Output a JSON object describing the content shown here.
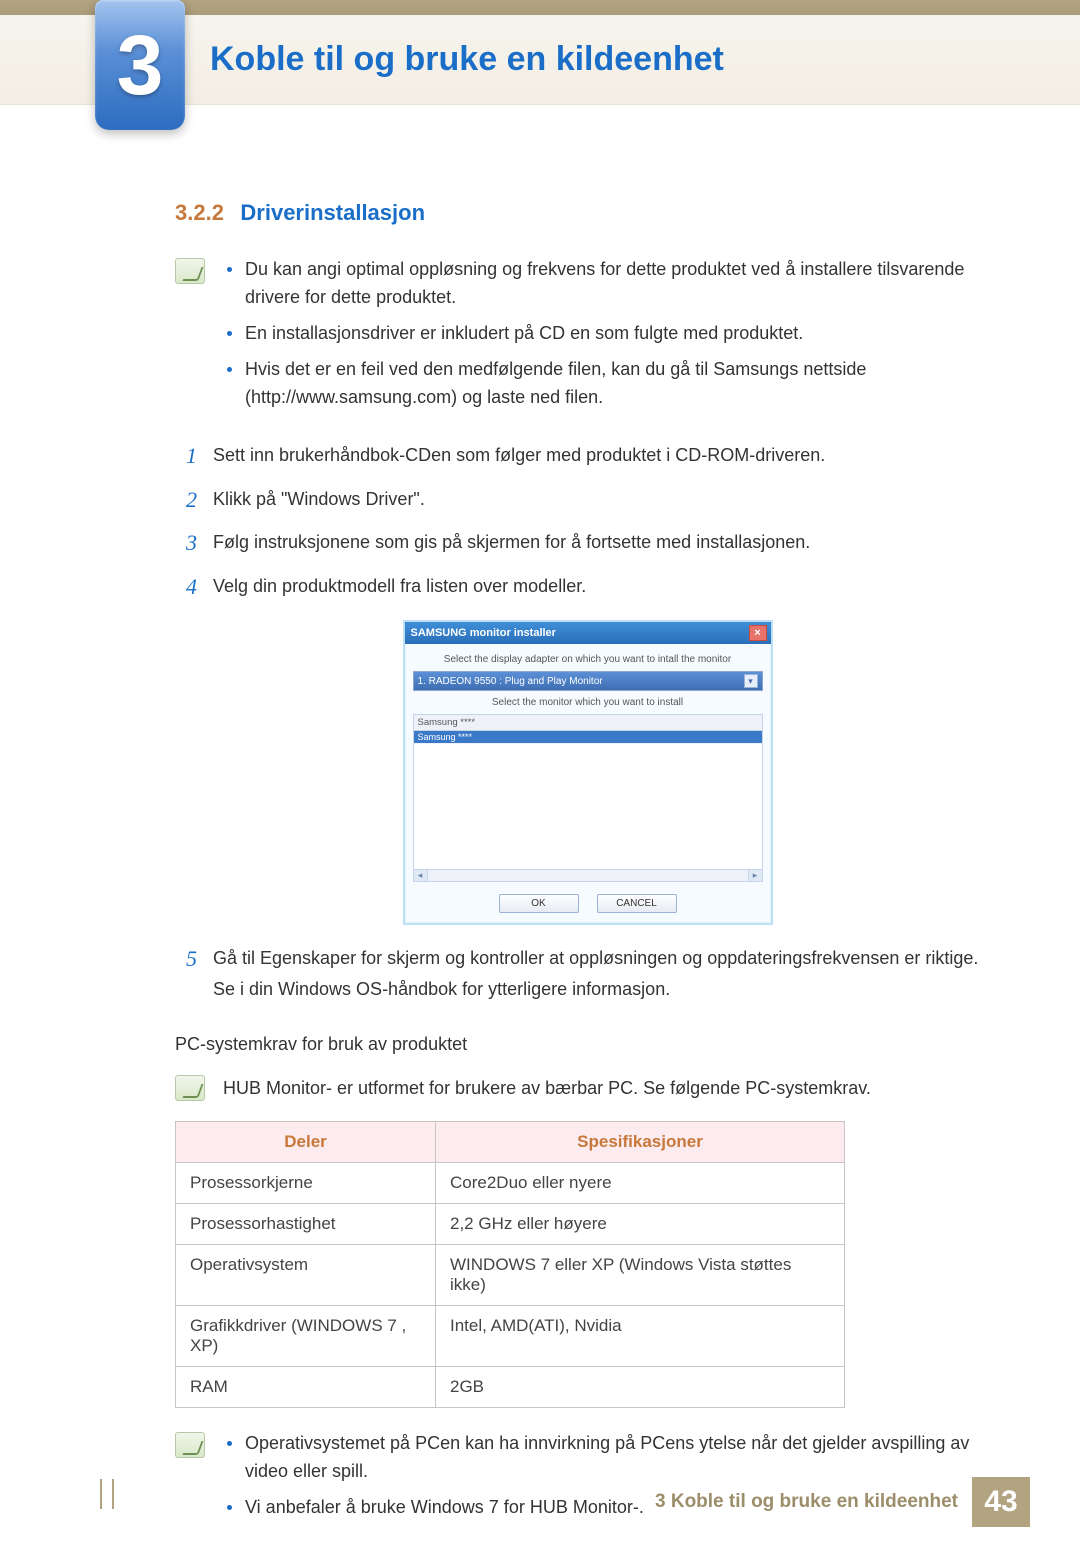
{
  "chapter": {
    "number": "3",
    "title": "Koble til og bruke en kildeenhet"
  },
  "section": {
    "number": "3.2.2",
    "title": "Driverinstallasjon"
  },
  "notes1": [
    "Du kan angi optimal oppløsning og frekvens for dette produktet ved å installere tilsvarende drivere for dette produktet.",
    "En installasjonsdriver er inkludert på CD en som fulgte med produktet.",
    "Hvis det er en feil ved den medfølgende filen, kan du gå til Samsungs nettside (http://www.samsung.com) og laste ned filen."
  ],
  "steps": [
    "Sett inn brukerhåndbok-CDen som følger med produktet i CD-ROM-driveren.",
    "Klikk på \"Windows Driver\".",
    "Følg instruksjonene som gis på skjermen for å fortsette med installasjonen.",
    "Velg din produktmodell fra listen over modeller.",
    "Gå til Egenskaper for skjerm og kontroller at oppløsningen og oppdateringsfrekvensen er riktige. Se i din Windows OS-håndbok for ytterligere informasjon."
  ],
  "dialog": {
    "title": "SAMSUNG monitor installer",
    "label1": "Select the display adapter on which you want to intall the monitor",
    "select_value": "1. RADEON 9550 : Plug and Play Monitor",
    "label2": "Select the monitor which you want to install",
    "list_head": "Samsung ****",
    "list_sel": "Samsung ****",
    "ok": "OK",
    "cancel": "CANCEL"
  },
  "sys_title": "PC-systemkrav for bruk av produktet",
  "note2": "HUB Monitor- er utformet for brukere av bærbar PC. Se følgende PC-systemkrav.",
  "spec_head": {
    "c1": "Deler",
    "c2": "Spesifikasjoner"
  },
  "spec_rows": [
    {
      "c1": "Prosessorkjerne",
      "c2": "Core2Duo eller nyere"
    },
    {
      "c1": "Prosessorhastighet",
      "c2": "2,2 GHz eller høyere"
    },
    {
      "c1": "Operativsystem",
      "c2": "WINDOWS 7 eller XP (Windows Vista støttes ikke)"
    },
    {
      "c1": "Grafikkdriver (WINDOWS 7 , XP)",
      "c2": "Intel, AMD(ATI), Nvidia"
    },
    {
      "c1": "RAM",
      "c2": "2GB"
    }
  ],
  "notes3": [
    "Operativsystemet på PCen kan ha innvirkning på PCens ytelse når det gjelder avspilling av video eller spill.",
    "Vi anbefaler å bruke Windows 7 for HUB Monitor-."
  ],
  "footer": {
    "text": "3 Koble til og bruke en kildeenhet",
    "page": "43"
  }
}
